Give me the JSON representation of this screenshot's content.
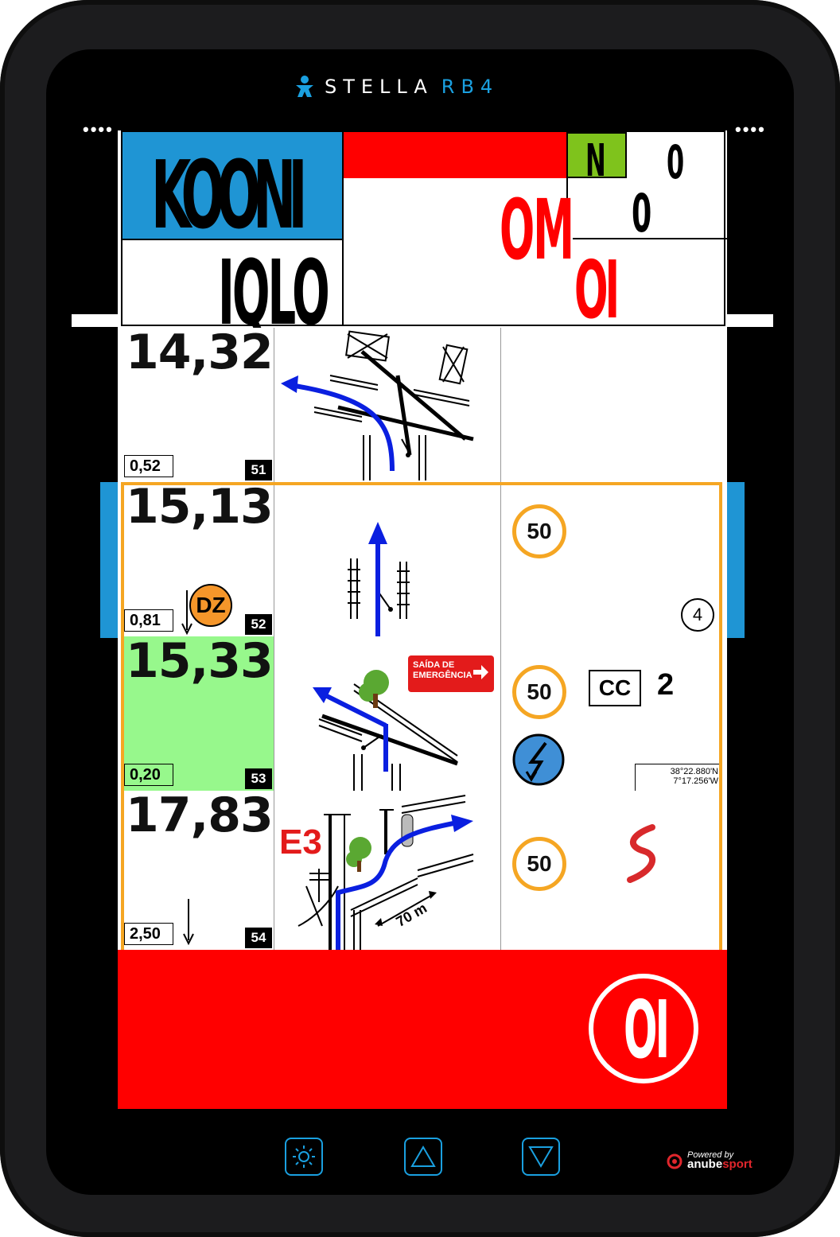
{
  "device": {
    "brand_name": "STELLA",
    "brand_model": "RB4",
    "dots_left": "••••",
    "dots_right": "••••",
    "powered_by": "Powered by",
    "powered_brand_a": "anube",
    "powered_brand_b": "sport"
  },
  "header": {
    "top_left_code": "KOONI",
    "bottom_left_code": "IQLO",
    "gear": "N",
    "top_right_value": "0",
    "mid_right_value": "0",
    "center_red_code": "OM",
    "lower_red_code": "OI"
  },
  "rows": [
    {
      "distance": "14,32",
      "partial": "0,52",
      "number": "51"
    },
    {
      "distance": "15,13",
      "partial": "0,81",
      "number": "52",
      "badge": "DZ",
      "speed": "50",
      "circle_num": "4"
    },
    {
      "distance": "15,33",
      "partial": "0,20",
      "number": "53",
      "speed": "50",
      "cc_label": "CC",
      "cc_value": "2",
      "exit_line1": "SAÍDA DE",
      "exit_line2": "EMERGÊNCIA",
      "gps_line1": "38°22.880'N",
      "gps_line2": "7°17.256'W"
    },
    {
      "distance": "17,83",
      "partial": "2,50",
      "number": "54",
      "speed": "50",
      "waypoint": "E3",
      "dist_label": "70 m"
    }
  ],
  "bottom": {
    "code": "OI"
  },
  "colors": {
    "red": "#ff0000",
    "blue": "#1f95d4",
    "orange": "#f5a623",
    "green": "#97f88c",
    "gear_green": "#7fc31c"
  },
  "hw_buttons": [
    "brightness-icon",
    "up-triangle-icon",
    "down-triangle-icon"
  ]
}
